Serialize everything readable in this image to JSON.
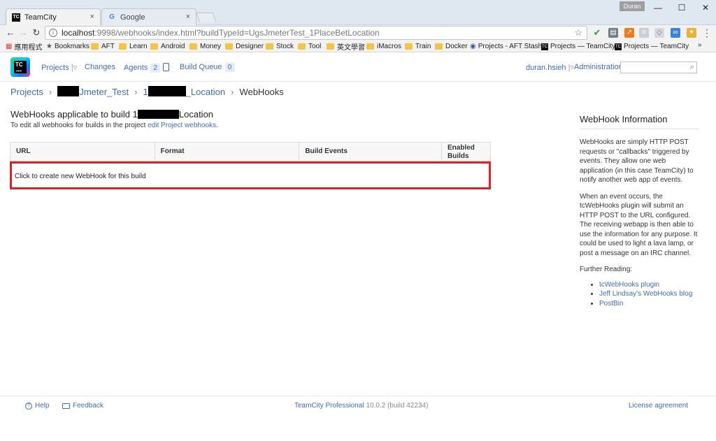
{
  "browser": {
    "tabs": [
      {
        "title": "TeamCity",
        "close": "×"
      },
      {
        "title": "Google",
        "close": "×"
      }
    ],
    "user_badge": "Duran",
    "window_controls": {
      "minimize": "—",
      "maximize": "☐",
      "close": "✕"
    },
    "nav": {
      "back": "←",
      "forward": "→",
      "reload": "↻"
    },
    "address": {
      "host": "localhost",
      "rest": ":9998/webhooks/index.html?buildTypeId=UgsJmeterTest_1PlaceBetLocation"
    },
    "bookmarks": [
      {
        "label": "應用程式",
        "kind": "apps"
      },
      {
        "label": "Bookmarks",
        "kind": "star"
      },
      {
        "label": "AFT",
        "kind": "folder"
      },
      {
        "label": "Learn",
        "kind": "folder"
      },
      {
        "label": "Android",
        "kind": "folder"
      },
      {
        "label": "Money",
        "kind": "folder"
      },
      {
        "label": "Designer",
        "kind": "folder"
      },
      {
        "label": "Stock",
        "kind": "folder"
      },
      {
        "label": "Tool",
        "kind": "folder"
      },
      {
        "label": "英文學習",
        "kind": "folder"
      },
      {
        "label": "iMacros",
        "kind": "folder"
      },
      {
        "label": "Train",
        "kind": "folder"
      },
      {
        "label": "Docker",
        "kind": "folder"
      },
      {
        "label": "Projects - AFT Stash",
        "kind": "globe"
      },
      {
        "label": "Projects — TeamCity",
        "kind": "tc"
      },
      {
        "label": "Projects — TeamCity",
        "kind": "tc"
      }
    ],
    "bookmarks_more": "»"
  },
  "teamcity": {
    "logo_text": "TC",
    "nav": {
      "projects": "Projects",
      "changes": "Changes",
      "agents": "Agents",
      "agents_count": "2",
      "build_queue": "Build Queue",
      "build_queue_count": "0",
      "user": "duran.hsieh",
      "administration": "Administration"
    },
    "breadcrumb": {
      "projects": "Projects",
      "project_suffix": "Jmeter_Test",
      "build_prefix": "1",
      "build_suffix": "_Location",
      "current": "WebHooks",
      "separator": "›"
    },
    "page_title_prefix": "WebHooks applicable to build 1",
    "page_title_suffix": "Location",
    "subtitle_text": "To edit all webhooks for builds in the project ",
    "subtitle_link": "edit Project webhooks",
    "subtitle_end": ".",
    "table": {
      "columns": [
        "URL",
        "Format",
        "Build Events",
        "Enabled Builds"
      ],
      "create_row": "Click to create new WebHook for this build"
    },
    "side_panel": {
      "title": "WebHook Information",
      "p1": "WebHooks are simply HTTP POST requests or \"callbacks\" triggered by events. They allow one web application (in this case TeamCity) to notify another web app of events.",
      "p2": "When an event occurs, the tcWebHooks plugin will submit an HTTP POST to the URL configured. The receiving webapp is then able to use the information for any purpose. It could be used to light a lava lamp, or post a message on an IRC channel.",
      "further": "Further Reading:",
      "links": [
        "tcWebHooks plugin",
        "Jeff Lindsay's WebHooks blog",
        "PostBin"
      ]
    },
    "footer": {
      "help": "Help",
      "feedback": "Feedback",
      "product": "TeamCity Professional",
      "version": "10.0.2 (build 42234)",
      "license": "License agreement"
    }
  }
}
